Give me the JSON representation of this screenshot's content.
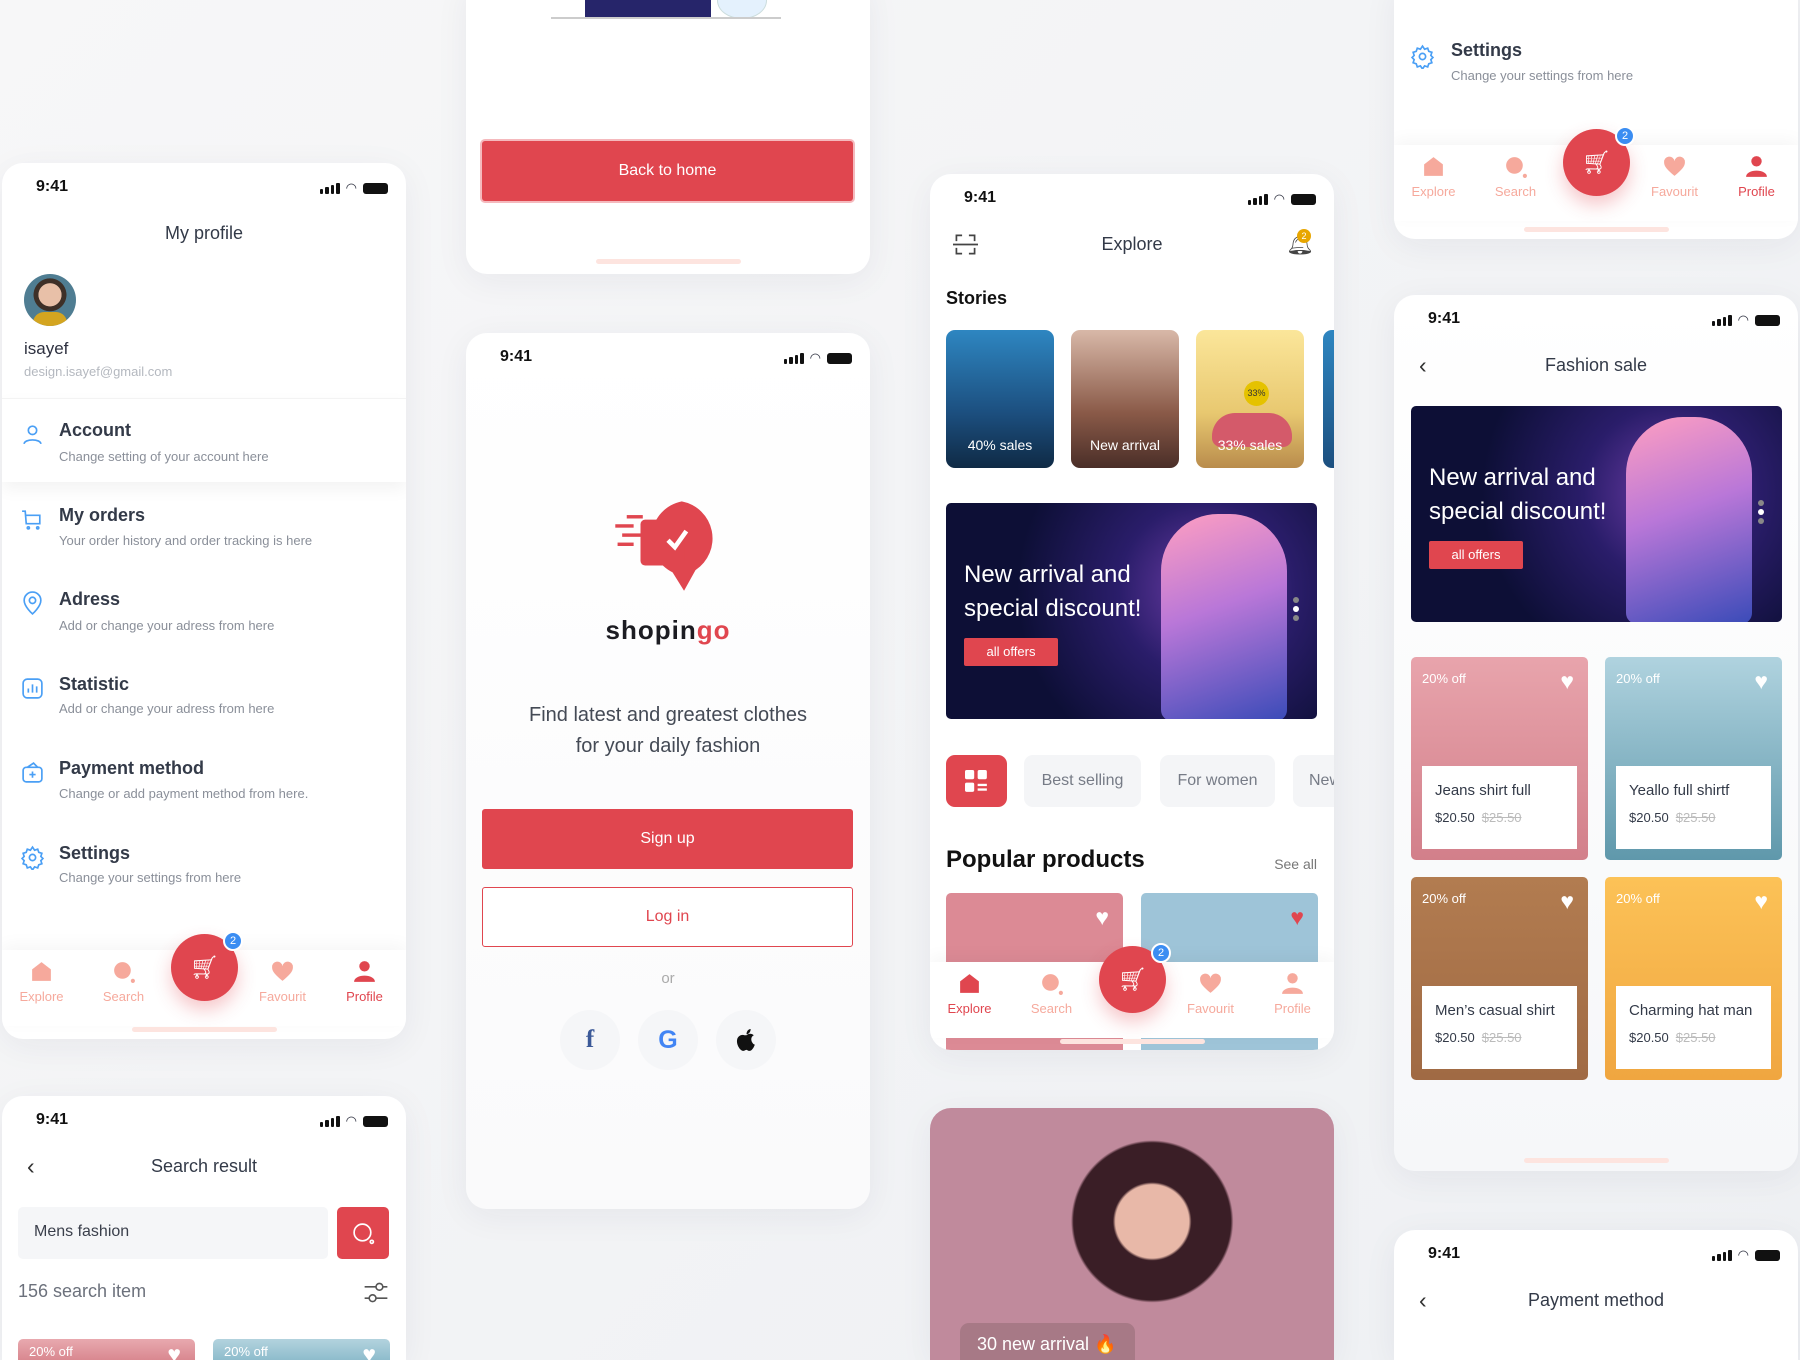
{
  "status": {
    "time": "9:41"
  },
  "colors": {
    "accent": "#e0464f",
    "icon_blue": "#4a9ff5",
    "badge_blue": "#3b8df2",
    "nav_inactive": "#f6a99c"
  },
  "nav": {
    "items": [
      "Explore",
      "Search",
      "Favourit",
      "Profile"
    ],
    "cart_badge": "2"
  },
  "profile": {
    "title": "My profile",
    "name": "isayef",
    "email": "design.isayef@gmail.com",
    "items": [
      {
        "title": "Account",
        "sub": "Change setting of your account here",
        "icon": "user-icon"
      },
      {
        "title": "My orders",
        "sub": "Your order history and order tracking is here",
        "icon": "cart-icon"
      },
      {
        "title": "Adress",
        "sub": "Add or change your adress from here",
        "icon": "location-pin-icon"
      },
      {
        "title": "Statistic",
        "sub": "Add or change your adress from here",
        "icon": "chart-icon"
      },
      {
        "title": "Payment method",
        "sub": "Change or add payment method from here.",
        "icon": "wallet-icon"
      },
      {
        "title": "Settings",
        "sub": "Change your settings from here",
        "icon": "gear-icon"
      }
    ]
  },
  "back_home": {
    "button": "Back to home"
  },
  "login": {
    "brand_a": "shopin",
    "brand_b": "go",
    "tagline1": "Find latest and greatest clothes",
    "tagline2": "for your daily fashion",
    "signup": "Sign up",
    "login": "Log in",
    "or": "or"
  },
  "explore": {
    "title": "Explore",
    "notif_badge": "2",
    "stories_title": "Stories",
    "stories": [
      "40% sales",
      "New arrival",
      "33% sales"
    ],
    "story_tag": "33%",
    "banner": {
      "title1": "New arrival and",
      "title2": "special discount!",
      "button": "all offers"
    },
    "chips": [
      "Best selling",
      "For women",
      "New"
    ],
    "popular_title": "Popular products",
    "see_all": "See all"
  },
  "photo_card": {
    "label": "30 new arrival 🔥"
  },
  "settings_top": {
    "title": "Settings",
    "sub": "Change your settings from here"
  },
  "fashion": {
    "title": "Fashion sale",
    "banner": {
      "title1": "New arrival and",
      "title2": "special discount!",
      "button": "all offers"
    },
    "products": [
      {
        "name": "Jeans shirt full",
        "price": "$20.50",
        "old": "$25.50",
        "off": "20% off"
      },
      {
        "name": "Yeallo full shirtf",
        "price": "$20.50",
        "old": "$25.50",
        "off": "20% off"
      },
      {
        "name": "Men’s casual shirt",
        "price": "$20.50",
        "old": "$25.50",
        "off": "20% off"
      },
      {
        "name": "Charming hat man",
        "price": "$20.50",
        "old": "$25.50",
        "off": "20% off"
      }
    ]
  },
  "search": {
    "title": "Search result",
    "query": "Mens fashion",
    "count": "156 search item",
    "card_off": "20% off"
  },
  "payment": {
    "title": "Payment method"
  }
}
